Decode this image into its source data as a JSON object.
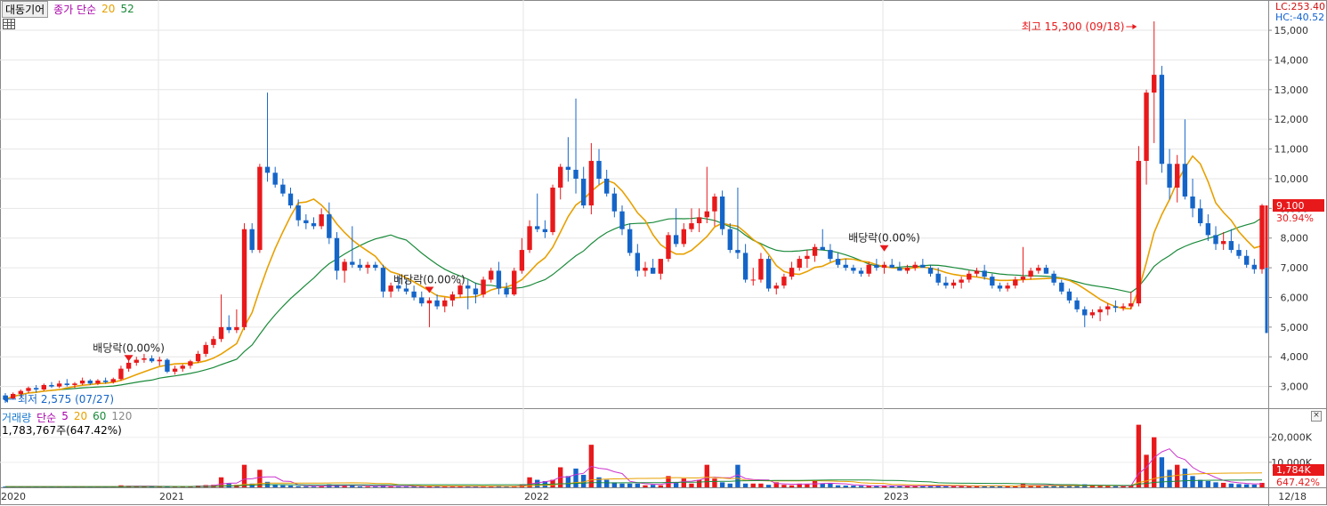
{
  "header": {
    "stock_name": "대동기어",
    "series_label": "종가 단순",
    "ma_a": "20",
    "ma_b": "52"
  },
  "top_right": {
    "lc": "LC:253.40",
    "hc": "HC:-40.52"
  },
  "volume_header": {
    "label": "거래량",
    "mode": "단순",
    "ma5": "5",
    "ma20": "20",
    "ma60": "60",
    "ma120": "120",
    "value": "1,783,767주(647.42%)"
  },
  "annotations": {
    "high": "최고 15,300 (09/18)",
    "low": "최저 2,575 (07/27)",
    "dividend": "배당락(0.00%)"
  },
  "badges": {
    "price": "9,100",
    "pct": "30.94%",
    "vol": "1,784K",
    "vol_pct": "647.42%"
  },
  "colors": {
    "up": "#e8191b",
    "down": "#1565c8",
    "ma20": "#e8a000",
    "ma52": "#1a8a3a",
    "vol_ma": "#cc33cc"
  },
  "chart_data": {
    "type": "candlestick",
    "y_ticks": [
      "3,000",
      "4,000",
      "5,000",
      "6,000",
      "7,000",
      "8,000",
      "9,000",
      "10,000",
      "11,000",
      "12,000",
      "13,000",
      "14,000",
      "15,000"
    ],
    "vol_ticks": [
      "10,000K",
      "20,000K"
    ],
    "x_labels": [
      "2020",
      "2021",
      "2022",
      "2023"
    ],
    "date_label": "12/18",
    "ylim": [
      2300,
      15600
    ],
    "candles": [
      [
        2700,
        2780,
        2450,
        2575
      ],
      [
        2600,
        2800,
        2560,
        2750
      ],
      [
        2750,
        2900,
        2650,
        2850
      ],
      [
        2850,
        3000,
        2780,
        2950
      ],
      [
        2950,
        3050,
        2800,
        2900
      ],
      [
        2900,
        3100,
        2850,
        3050
      ],
      [
        3050,
        3150,
        2950,
        3000
      ],
      [
        3000,
        3200,
        2950,
        3100
      ],
      [
        3100,
        3250,
        3000,
        3050
      ],
      [
        3050,
        3150,
        2950,
        3100
      ],
      [
        3100,
        3300,
        3050,
        3200
      ],
      [
        3200,
        3250,
        3050,
        3100
      ],
      [
        3100,
        3250,
        3050,
        3200
      ],
      [
        3200,
        3300,
        3100,
        3150
      ],
      [
        3150,
        3300,
        3100,
        3250
      ],
      [
        3250,
        3700,
        3200,
        3600
      ],
      [
        3600,
        3900,
        3500,
        3800
      ],
      [
        3800,
        4000,
        3700,
        3900
      ],
      [
        3900,
        4100,
        3800,
        3950
      ],
      [
        3950,
        4050,
        3800,
        3850
      ],
      [
        3850,
        4000,
        3700,
        3900
      ],
      [
        3900,
        3950,
        3450,
        3500
      ],
      [
        3500,
        3700,
        3400,
        3600
      ],
      [
        3600,
        3750,
        3500,
        3700
      ],
      [
        3700,
        3900,
        3600,
        3850
      ],
      [
        3850,
        4200,
        3800,
        4100
      ],
      [
        4100,
        4500,
        4000,
        4400
      ],
      [
        4400,
        4700,
        4300,
        4600
      ],
      [
        4600,
        6100,
        4500,
        5000
      ],
      [
        5000,
        5400,
        4800,
        4900
      ],
      [
        4900,
        5600,
        4800,
        5000
      ],
      [
        5000,
        8500,
        4900,
        8300
      ],
      [
        8300,
        8500,
        7500,
        7600
      ],
      [
        7600,
        10500,
        7500,
        10400
      ],
      [
        10400,
        12900,
        9900,
        10200
      ],
      [
        10200,
        10400,
        9700,
        9800
      ],
      [
        9800,
        10000,
        9400,
        9500
      ],
      [
        9500,
        9700,
        9000,
        9100
      ],
      [
        9100,
        9300,
        8400,
        8600
      ],
      [
        8600,
        8800,
        8300,
        8500
      ],
      [
        8500,
        8700,
        8300,
        8400
      ],
      [
        8400,
        9000,
        8300,
        8800
      ],
      [
        8800,
        9200,
        7800,
        8000
      ],
      [
        8000,
        8200,
        6600,
        6900
      ],
      [
        6900,
        7300,
        6500,
        7200
      ],
      [
        7200,
        8400,
        7000,
        7100
      ],
      [
        7100,
        7300,
        6900,
        7000
      ],
      [
        7000,
        7200,
        6800,
        7100
      ],
      [
        7100,
        7200,
        6900,
        7000
      ],
      [
        7000,
        7100,
        6000,
        6200
      ],
      [
        6200,
        6500,
        6000,
        6400
      ],
      [
        6400,
        6700,
        6200,
        6300
      ],
      [
        6300,
        6600,
        6100,
        6200
      ],
      [
        6200,
        6400,
        5900,
        6000
      ],
      [
        6000,
        6200,
        5700,
        5800
      ],
      [
        5800,
        6000,
        5000,
        5900
      ],
      [
        5900,
        6100,
        5600,
        5700
      ],
      [
        5700,
        6000,
        5500,
        5900
      ],
      [
        5900,
        6200,
        5700,
        6100
      ],
      [
        6100,
        6500,
        6000,
        6400
      ],
      [
        6400,
        6600,
        5600,
        6300
      ],
      [
        6300,
        6500,
        5800,
        6100
      ],
      [
        6100,
        6700,
        6000,
        6600
      ],
      [
        6600,
        7000,
        6500,
        6900
      ],
      [
        6900,
        7200,
        6100,
        6300
      ],
      [
        6300,
        6500,
        6000,
        6100
      ],
      [
        6100,
        7000,
        6050,
        6900
      ],
      [
        6900,
        8000,
        6800,
        7600
      ],
      [
        7600,
        8600,
        7500,
        8400
      ],
      [
        8400,
        9500,
        8200,
        8300
      ],
      [
        8300,
        8600,
        8000,
        8200
      ],
      [
        8200,
        9800,
        8100,
        9700
      ],
      [
        9700,
        10500,
        9300,
        10400
      ],
      [
        10400,
        11400,
        9900,
        10300
      ],
      [
        10300,
        12700,
        9500,
        10000
      ],
      [
        10000,
        10400,
        9000,
        9100
      ],
      [
        9100,
        11200,
        8800,
        10600
      ],
      [
        10600,
        11000,
        9800,
        10000
      ],
      [
        10000,
        10300,
        9400,
        9500
      ],
      [
        9500,
        9700,
        8700,
        8900
      ],
      [
        8900,
        9100,
        8100,
        8300
      ],
      [
        8300,
        8500,
        7400,
        7500
      ],
      [
        7500,
        7800,
        6700,
        6900
      ],
      [
        6900,
        7200,
        6700,
        7000
      ],
      [
        7000,
        7300,
        6800,
        6800
      ],
      [
        6800,
        7100,
        6600,
        7300
      ],
      [
        7300,
        8200,
        7200,
        8100
      ],
      [
        8100,
        9000,
        7700,
        7800
      ],
      [
        7800,
        8500,
        7700,
        8300
      ],
      [
        8300,
        9000,
        8200,
        8500
      ],
      [
        8500,
        9000,
        8200,
        8700
      ],
      [
        8700,
        10400,
        8500,
        8900
      ],
      [
        8900,
        9500,
        8400,
        9400
      ],
      [
        9400,
        9600,
        8100,
        8300
      ],
      [
        8300,
        8500,
        7500,
        7600
      ],
      [
        7600,
        9700,
        7300,
        7500
      ],
      [
        7500,
        7800,
        6500,
        6600
      ],
      [
        6600,
        7000,
        6400,
        6600
      ],
      [
        6600,
        7500,
        6500,
        7300
      ],
      [
        7300,
        7400,
        6200,
        6300
      ],
      [
        6300,
        6500,
        6100,
        6400
      ],
      [
        6400,
        6800,
        6300,
        6700
      ],
      [
        6700,
        7200,
        6600,
        7000
      ],
      [
        7000,
        7400,
        6900,
        7300
      ],
      [
        7300,
        7600,
        7000,
        7400
      ],
      [
        7400,
        7800,
        7200,
        7700
      ],
      [
        7700,
        8300,
        7600,
        7600
      ],
      [
        7600,
        7800,
        7200,
        7300
      ],
      [
        7300,
        7500,
        7000,
        7100
      ],
      [
        7100,
        7300,
        6900,
        7000
      ],
      [
        7000,
        7100,
        6800,
        6900
      ],
      [
        6900,
        7000,
        6700,
        6800
      ],
      [
        6800,
        7200,
        6700,
        7100
      ],
      [
        7100,
        7300,
        6900,
        7000
      ],
      [
        7000,
        7200,
        6800,
        7100
      ],
      [
        7100,
        7300,
        7000,
        7000
      ],
      [
        7000,
        7200,
        6900,
        6900
      ],
      [
        6900,
        7100,
        6800,
        7000
      ],
      [
        7000,
        7200,
        6900,
        7100
      ],
      [
        7100,
        7300,
        7000,
        7000
      ],
      [
        7000,
        7100,
        6700,
        6800
      ],
      [
        6800,
        7000,
        6400,
        6500
      ],
      [
        6500,
        6700,
        6300,
        6400
      ],
      [
        6400,
        6600,
        6300,
        6500
      ],
      [
        6500,
        6700,
        6300,
        6600
      ],
      [
        6600,
        6900,
        6500,
        6800
      ],
      [
        6800,
        7000,
        6700,
        6900
      ],
      [
        6900,
        7100,
        6600,
        6700
      ],
      [
        6700,
        6800,
        6300,
        6400
      ],
      [
        6400,
        6500,
        6200,
        6300
      ],
      [
        6300,
        6500,
        6200,
        6400
      ],
      [
        6400,
        6700,
        6300,
        6600
      ],
      [
        6600,
        7700,
        6500,
        6700
      ],
      [
        6700,
        7000,
        6600,
        6900
      ],
      [
        6900,
        7100,
        6800,
        7000
      ],
      [
        7000,
        7100,
        6800,
        6800
      ],
      [
        6800,
        6900,
        6400,
        6500
      ],
      [
        6500,
        6600,
        6100,
        6200
      ],
      [
        6200,
        6300,
        5800,
        5900
      ],
      [
        5900,
        6000,
        5500,
        5600
      ],
      [
        5600,
        5700,
        5000,
        5400
      ],
      [
        5400,
        5600,
        5300,
        5500
      ],
      [
        5500,
        5700,
        5200,
        5600
      ],
      [
        5600,
        5800,
        5400,
        5700
      ],
      [
        5700,
        5900,
        5500,
        5650
      ],
      [
        5650,
        5800,
        5550,
        5700
      ],
      [
        5700,
        6200,
        5600,
        5800
      ],
      [
        5800,
        11100,
        5700,
        10600
      ],
      [
        10600,
        13000,
        9800,
        12900
      ],
      [
        12900,
        15300,
        11200,
        13500
      ],
      [
        13500,
        13800,
        10200,
        10500
      ],
      [
        10500,
        11000,
        9300,
        9700
      ],
      [
        9700,
        10800,
        9200,
        10500
      ],
      [
        10500,
        12000,
        9300,
        9400
      ],
      [
        9400,
        10000,
        8700,
        9000
      ],
      [
        9000,
        9300,
        8400,
        8500
      ],
      [
        8500,
        8800,
        7900,
        8100
      ],
      [
        8100,
        8400,
        7600,
        7800
      ],
      [
        7800,
        8200,
        7600,
        7900
      ],
      [
        7900,
        8300,
        7500,
        7600
      ],
      [
        7600,
        7800,
        7300,
        7400
      ],
      [
        7400,
        7600,
        7000,
        7100
      ],
      [
        7100,
        7300,
        6800,
        6950
      ],
      [
        6950,
        9150,
        6800,
        9100
      ]
    ],
    "volume": [
      0.3,
      0.3,
      0.2,
      0.3,
      0.3,
      0.2,
      0.3,
      0.2,
      0.3,
      0.2,
      0.3,
      0.2,
      0.2,
      0.3,
      0.3,
      0.8,
      0.6,
      0.5,
      0.3,
      0.3,
      0.3,
      0.5,
      0.3,
      0.3,
      0.4,
      0.7,
      0.9,
      1.0,
      4.0,
      1.5,
      1.0,
      9.0,
      1.5,
      7.0,
      2.2,
      1.0,
      0.8,
      0.7,
      0.5,
      0.4,
      0.3,
      0.5,
      1.2,
      1.0,
      0.5,
      0.9,
      0.4,
      0.3,
      0.3,
      0.8,
      0.4,
      0.3,
      0.3,
      0.4,
      0.4,
      0.5,
      0.4,
      0.3,
      0.3,
      0.4,
      0.4,
      0.3,
      0.3,
      0.4,
      0.6,
      0.4,
      0.3,
      1.2,
      4.0,
      3.0,
      2.5,
      3.0,
      8.0,
      4.5,
      7.5,
      5.0,
      17.0,
      4.0,
      3.0,
      2.0,
      1.5,
      1.5,
      1.5,
      0.8,
      1.0,
      0.8,
      4.5,
      2.0,
      3.5,
      1.5,
      3.0,
      9.0,
      3.5,
      2.0,
      1.5,
      9.0,
      1.5,
      1.5,
      1.5,
      1.0,
      2.0,
      1.0,
      0.8,
      1.5,
      1.2,
      2.5,
      1.5,
      1.5,
      0.8,
      0.7,
      0.7,
      0.6,
      0.6,
      0.6,
      0.6,
      0.5,
      0.6,
      0.5,
      0.5,
      0.5,
      0.7,
      0.6,
      0.5,
      0.5,
      0.5,
      0.6,
      0.6,
      0.5,
      0.6,
      0.5,
      0.5,
      0.5,
      1.5,
      0.8,
      0.6,
      0.5,
      0.7,
      0.8,
      0.8,
      0.9,
      1.2,
      0.6,
      0.6,
      0.5,
      0.5,
      0.5,
      0.8,
      25.0,
      13.0,
      20.0,
      12.0,
      7.0,
      9.0,
      7.5,
      4.5,
      3.0,
      2.5,
      2.0,
      1.8,
      1.5,
      1.3,
      1.2,
      1.1,
      1.78
    ]
  }
}
